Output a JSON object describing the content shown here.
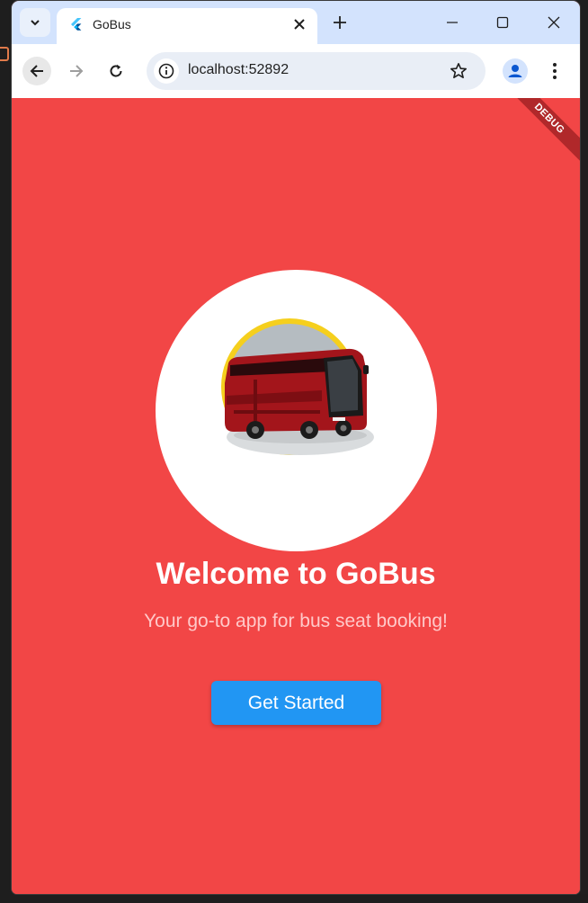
{
  "browser": {
    "tab_title": "GoBus",
    "url": "localhost:52892",
    "icons": {
      "tab_menu": "chevron-down-icon",
      "favicon": "flutter-icon",
      "tab_close": "close-icon",
      "new_tab": "plus-icon",
      "minimize": "minimize-icon",
      "maximize": "maximize-icon",
      "close_window": "close-icon",
      "back": "arrow-left-icon",
      "forward": "arrow-right-icon",
      "reload": "reload-icon",
      "site_info": "info-icon",
      "bookmark": "star-icon",
      "profile": "person-icon",
      "menu": "kebab-menu-icon"
    }
  },
  "app": {
    "debug_banner": "DEBUG",
    "title": "Welcome to GoBus",
    "subtitle": "Your go-to app for bus seat booking!",
    "cta_label": "Get Started",
    "colors": {
      "background": "#f24646",
      "button": "#2196f3",
      "logo_ring": "#f5cf1d",
      "bus": "#a3151b"
    }
  }
}
